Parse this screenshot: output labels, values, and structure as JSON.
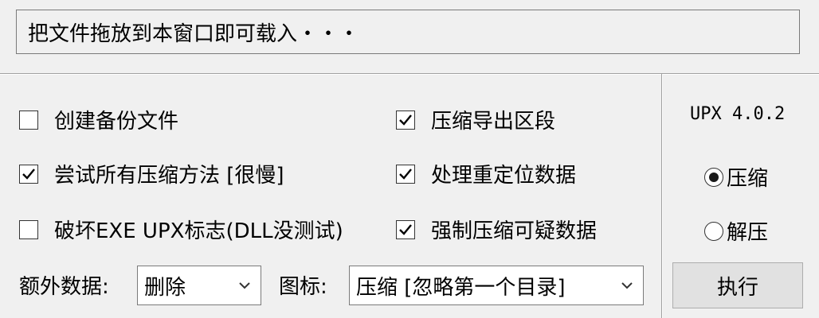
{
  "drop_zone": {
    "text": "把文件拖放到本窗口即可载入・・・"
  },
  "options": {
    "backup": {
      "label": "创建备份文件",
      "checked": false
    },
    "try_all": {
      "label": "尝试所有压缩方法 [很慢]",
      "checked": true
    },
    "break_exe": {
      "label": "破坏EXE UPX标志(DLL没测试)",
      "checked": false
    },
    "compress_export": {
      "label": "压缩导出区段",
      "checked": true
    },
    "handle_reloc": {
      "label": "处理重定位数据",
      "checked": true
    },
    "force_compress": {
      "label": "强制压缩可疑数据",
      "checked": true
    }
  },
  "extra_data": {
    "label": "额外数据:",
    "selected": "删除"
  },
  "icon": {
    "label": "图标:",
    "selected": "压缩 [忽略第一个目录]"
  },
  "side": {
    "version": "UPX 4.0.2",
    "mode_compress": "压缩",
    "mode_decompress": "解压",
    "mode_selected": "compress",
    "execute_label": "执行"
  }
}
